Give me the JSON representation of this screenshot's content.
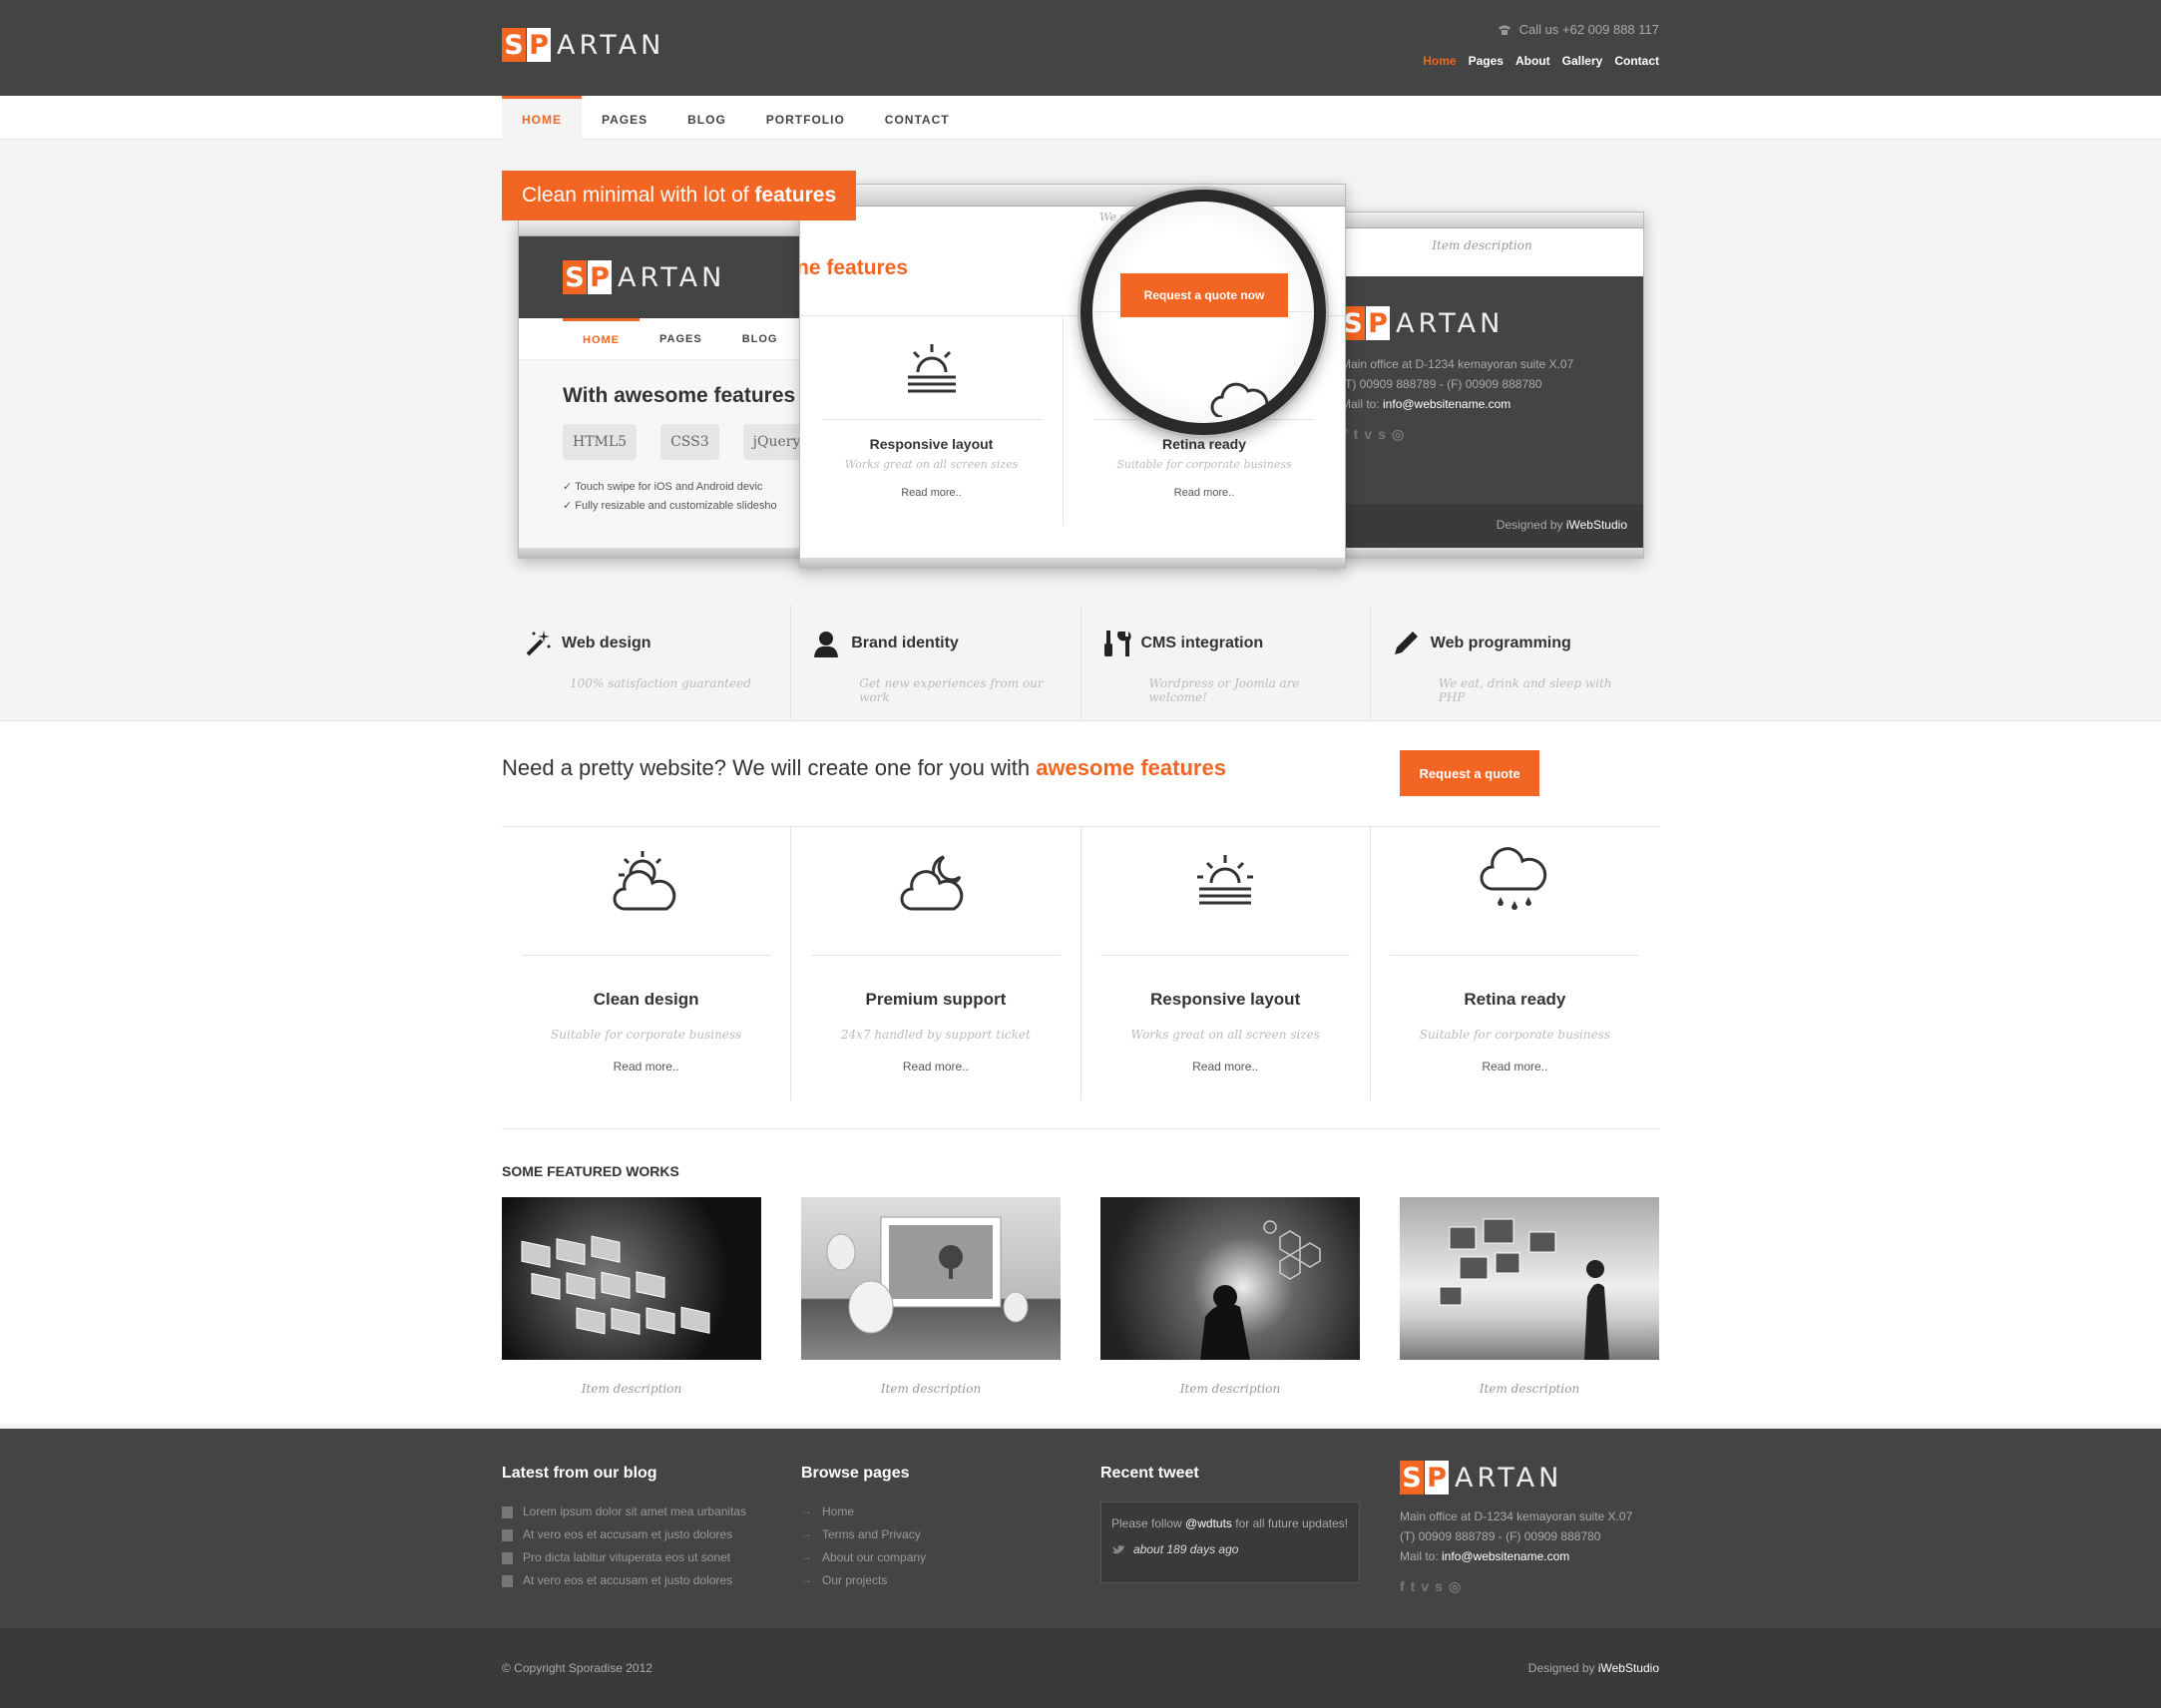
{
  "brand": {
    "logo_a": "S",
    "logo_b": "P",
    "logo_rest": "ARTAN",
    "accent": "#f26522"
  },
  "topbar": {
    "call": "Call us +62 009 888 117",
    "links": [
      {
        "label": "Home",
        "active": true
      },
      {
        "label": "Pages"
      },
      {
        "label": "About"
      },
      {
        "label": "Gallery"
      },
      {
        "label": "Contact"
      }
    ]
  },
  "nav": {
    "items": [
      "HOME",
      "PAGES",
      "BLOG",
      "PORTFOLIO",
      "CONTACT"
    ]
  },
  "hero": {
    "ribbon_pre": "Clean minimal with lot of ",
    "ribbon_bold": "features",
    "w1": {
      "nav": [
        "HOME",
        "PAGES",
        "BLOG"
      ],
      "heading": "With awesome features",
      "tags": [
        "HTML5",
        "CSS3",
        "jQuery"
      ],
      "checks": [
        "Touch swipe for iOS and Android devic",
        "Fully resizable and customizable slidesho"
      ]
    },
    "w2": {
      "heading": "ne features",
      "quote_btn": "Request a quote now",
      "top_text": "We eat, drink a",
      "f1_title": "Responsive layout",
      "f1_sub": "Works great on all screen sizes",
      "f2_title": "Retina ready",
      "f2_sub": "Suitable for corporate business",
      "read": "Read more.."
    },
    "w3": {
      "caption": "Item description",
      "addr1": "Main office at D-1234 kemayoran suite X.07",
      "addr2": "(T) 00909 888789 - (F) 00909 888780",
      "mail_pre": "Mail to: ",
      "mail": "info@websitename.com",
      "designed_pre": "Designed by ",
      "designed": "iWebStudio"
    }
  },
  "services": [
    {
      "title": "Web design",
      "sub": "100% satisfaction guaranteed",
      "icon": "magic-wand-icon"
    },
    {
      "title": "Brand identity",
      "sub": "Get new experiences from our work",
      "icon": "user-icon"
    },
    {
      "title": "CMS integration",
      "sub": "Wordpress or Joomla are welcome!",
      "icon": "tools-icon"
    },
    {
      "title": "Web programming",
      "sub": "We eat, drink and sleep with PHP",
      "icon": "pencil-icon"
    }
  ],
  "cta": {
    "text": "Need a pretty website? We will create one for you with ",
    "bold": "awesome features",
    "button": "Request a quote"
  },
  "features": [
    {
      "title": "Clean design",
      "sub": "Suitable for corporate business",
      "read": "Read more..",
      "icon": "sun-cloud-icon"
    },
    {
      "title": "Premium support",
      "sub": "24x7 handled by support ticket",
      "read": "Read more..",
      "icon": "moon-cloud-icon"
    },
    {
      "title": "Responsive layout",
      "sub": "Works great on all screen sizes",
      "read": "Read more..",
      "icon": "sunrise-icon"
    },
    {
      "title": "Retina ready",
      "sub": "Suitable for corporate business",
      "read": "Read more..",
      "icon": "rain-cloud-icon"
    }
  ],
  "works": {
    "title": "SOME FEATURED WORKS",
    "items": [
      "Item description",
      "Item description",
      "Item description",
      "Item description"
    ]
  },
  "footer": {
    "blog_title": "Latest from our blog",
    "blog": [
      "Lorem ipsum dolor sit amet mea urbanitas",
      "At vero eos et accusam et justo dolores",
      "Pro dicta labitur vituperata eos ut sonet",
      "At vero eos et accusam et justo dolores"
    ],
    "browse_title": "Browse pages",
    "browse": [
      "Home",
      "Terms and Privacy",
      "About our company",
      "Our projects"
    ],
    "tweet_title": "Recent tweet",
    "tweet_pre": "Please follow ",
    "tweet_user": "@wdtuts",
    "tweet_post": " for all future updates!",
    "tweet_when": "about 189 days ago",
    "addr1": "Main office at D-1234 kemayoran suite X.07",
    "addr2": "(T) 00909 888789 - (F) 00909 888780",
    "mail_pre": "Mail to: ",
    "mail": "info@websitename.com",
    "copyright": "© Copyright Sporadise 2012",
    "designed_pre": "Designed by ",
    "designed": "iWebStudio"
  }
}
